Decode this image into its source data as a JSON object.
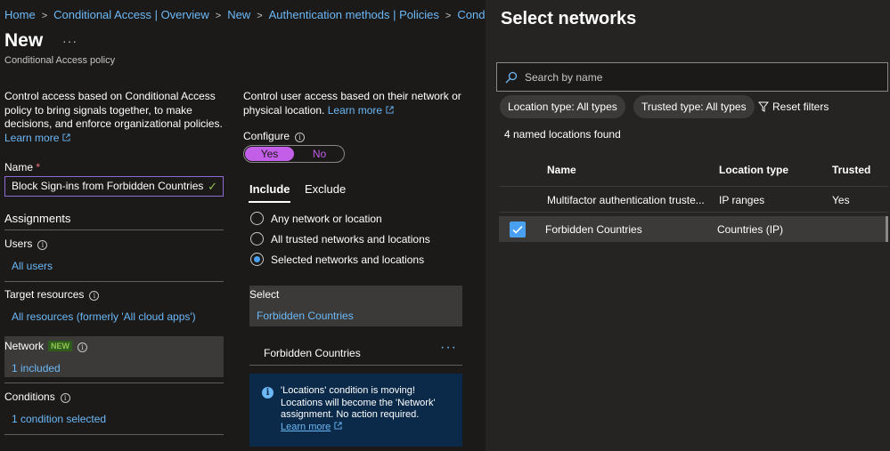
{
  "breadcrumb": [
    "Home",
    "Conditional Access | Overview",
    "New",
    "Authentication methods | Policies",
    "Conditional"
  ],
  "page": {
    "title": "New",
    "more_label": "···",
    "subtitle": "Conditional Access policy"
  },
  "left": {
    "description": "Control access based on Conditional Access policy to bring signals together, to make decisions, and enforce organizational policies.",
    "learn_more": "Learn more",
    "name_label": "Name",
    "required_mark": "*",
    "name_value": "Block Sign-ins from Forbidden Countries",
    "assignments_title": "Assignments",
    "users_label": "Users",
    "users_value": "All users",
    "target_label": "Target resources",
    "target_value": "All resources (formerly 'All cloud apps')",
    "network_label": "Network",
    "network_badge": "NEW",
    "network_value": "1 included",
    "conditions_label": "Conditions",
    "conditions_value": "1 condition selected"
  },
  "middle": {
    "description": "Control user access based on their network or physical location.",
    "learn_more": "Learn more",
    "configure_label": "Configure",
    "toggle_yes": "Yes",
    "toggle_no": "No",
    "tab_include": "Include",
    "tab_exclude": "Exclude",
    "radio_any": "Any network or location",
    "radio_trusted": "All trusted networks and locations",
    "radio_selected": "Selected networks and locations",
    "select_label": "Select",
    "select_value": "Forbidden Countries",
    "selected_item": "Forbidden Countries",
    "selected_item_more": "···",
    "notice_text": "'Locations' condition is moving! Locations will become the 'Network' assignment. No action required.",
    "notice_link": "Learn more"
  },
  "panel": {
    "title": "Select networks",
    "search_placeholder": "Search by name",
    "filter_location": "Location type: All types",
    "filter_trusted": "Trusted type: All types",
    "reset_filters": "Reset filters",
    "found_text": "4 named locations found",
    "columns": [
      "Name",
      "Location type",
      "Trusted"
    ],
    "rows": [
      {
        "name": "Multifactor authentication truste...",
        "type": "IP ranges",
        "trusted": "Yes"
      },
      {
        "name": "Forbidden Countries",
        "type": "Countries (IP)",
        "trusted": ""
      }
    ]
  },
  "colors": {
    "accent_purple": "#c25ee8",
    "link_blue": "#6cb8f6",
    "checkbox_blue": "#4aa0f0",
    "new_badge_green": "#92c353"
  }
}
